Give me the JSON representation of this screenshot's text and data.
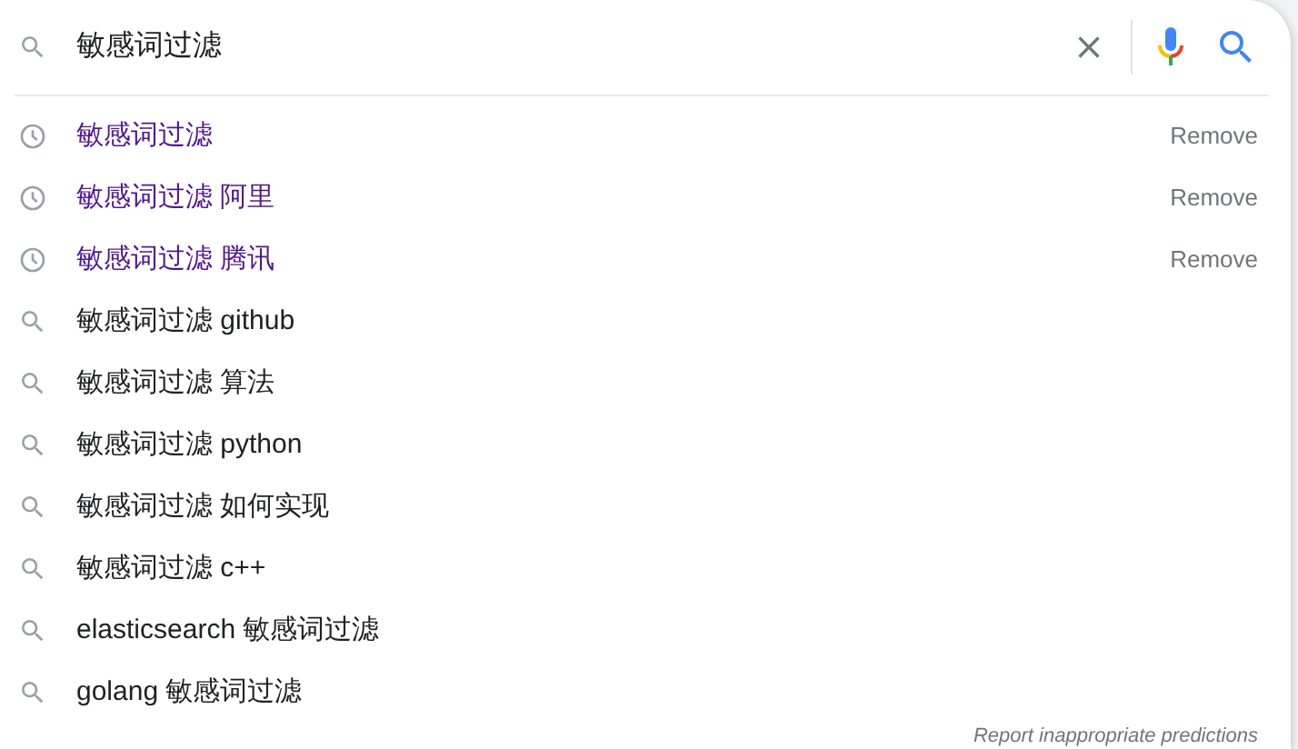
{
  "search": {
    "value": "敏感词过滤"
  },
  "suggestions": [
    {
      "kind": "history",
      "text": "敏感词过滤",
      "action": "Remove"
    },
    {
      "kind": "history",
      "text": "敏感词过滤 阿里",
      "action": "Remove"
    },
    {
      "kind": "history",
      "text": "敏感词过滤 腾讯",
      "action": "Remove"
    },
    {
      "kind": "search",
      "text": "敏感词过滤 github"
    },
    {
      "kind": "search",
      "text": "敏感词过滤 算法"
    },
    {
      "kind": "search",
      "text": "敏感词过滤 python"
    },
    {
      "kind": "search",
      "text": "敏感词过滤 如何实现"
    },
    {
      "kind": "search",
      "text": "敏感词过滤 c++"
    },
    {
      "kind": "search",
      "text": "elasticsearch 敏感词过滤"
    },
    {
      "kind": "search",
      "text": "golang 敏感词过滤"
    }
  ],
  "footer_link": "Report inappropriate predictions"
}
